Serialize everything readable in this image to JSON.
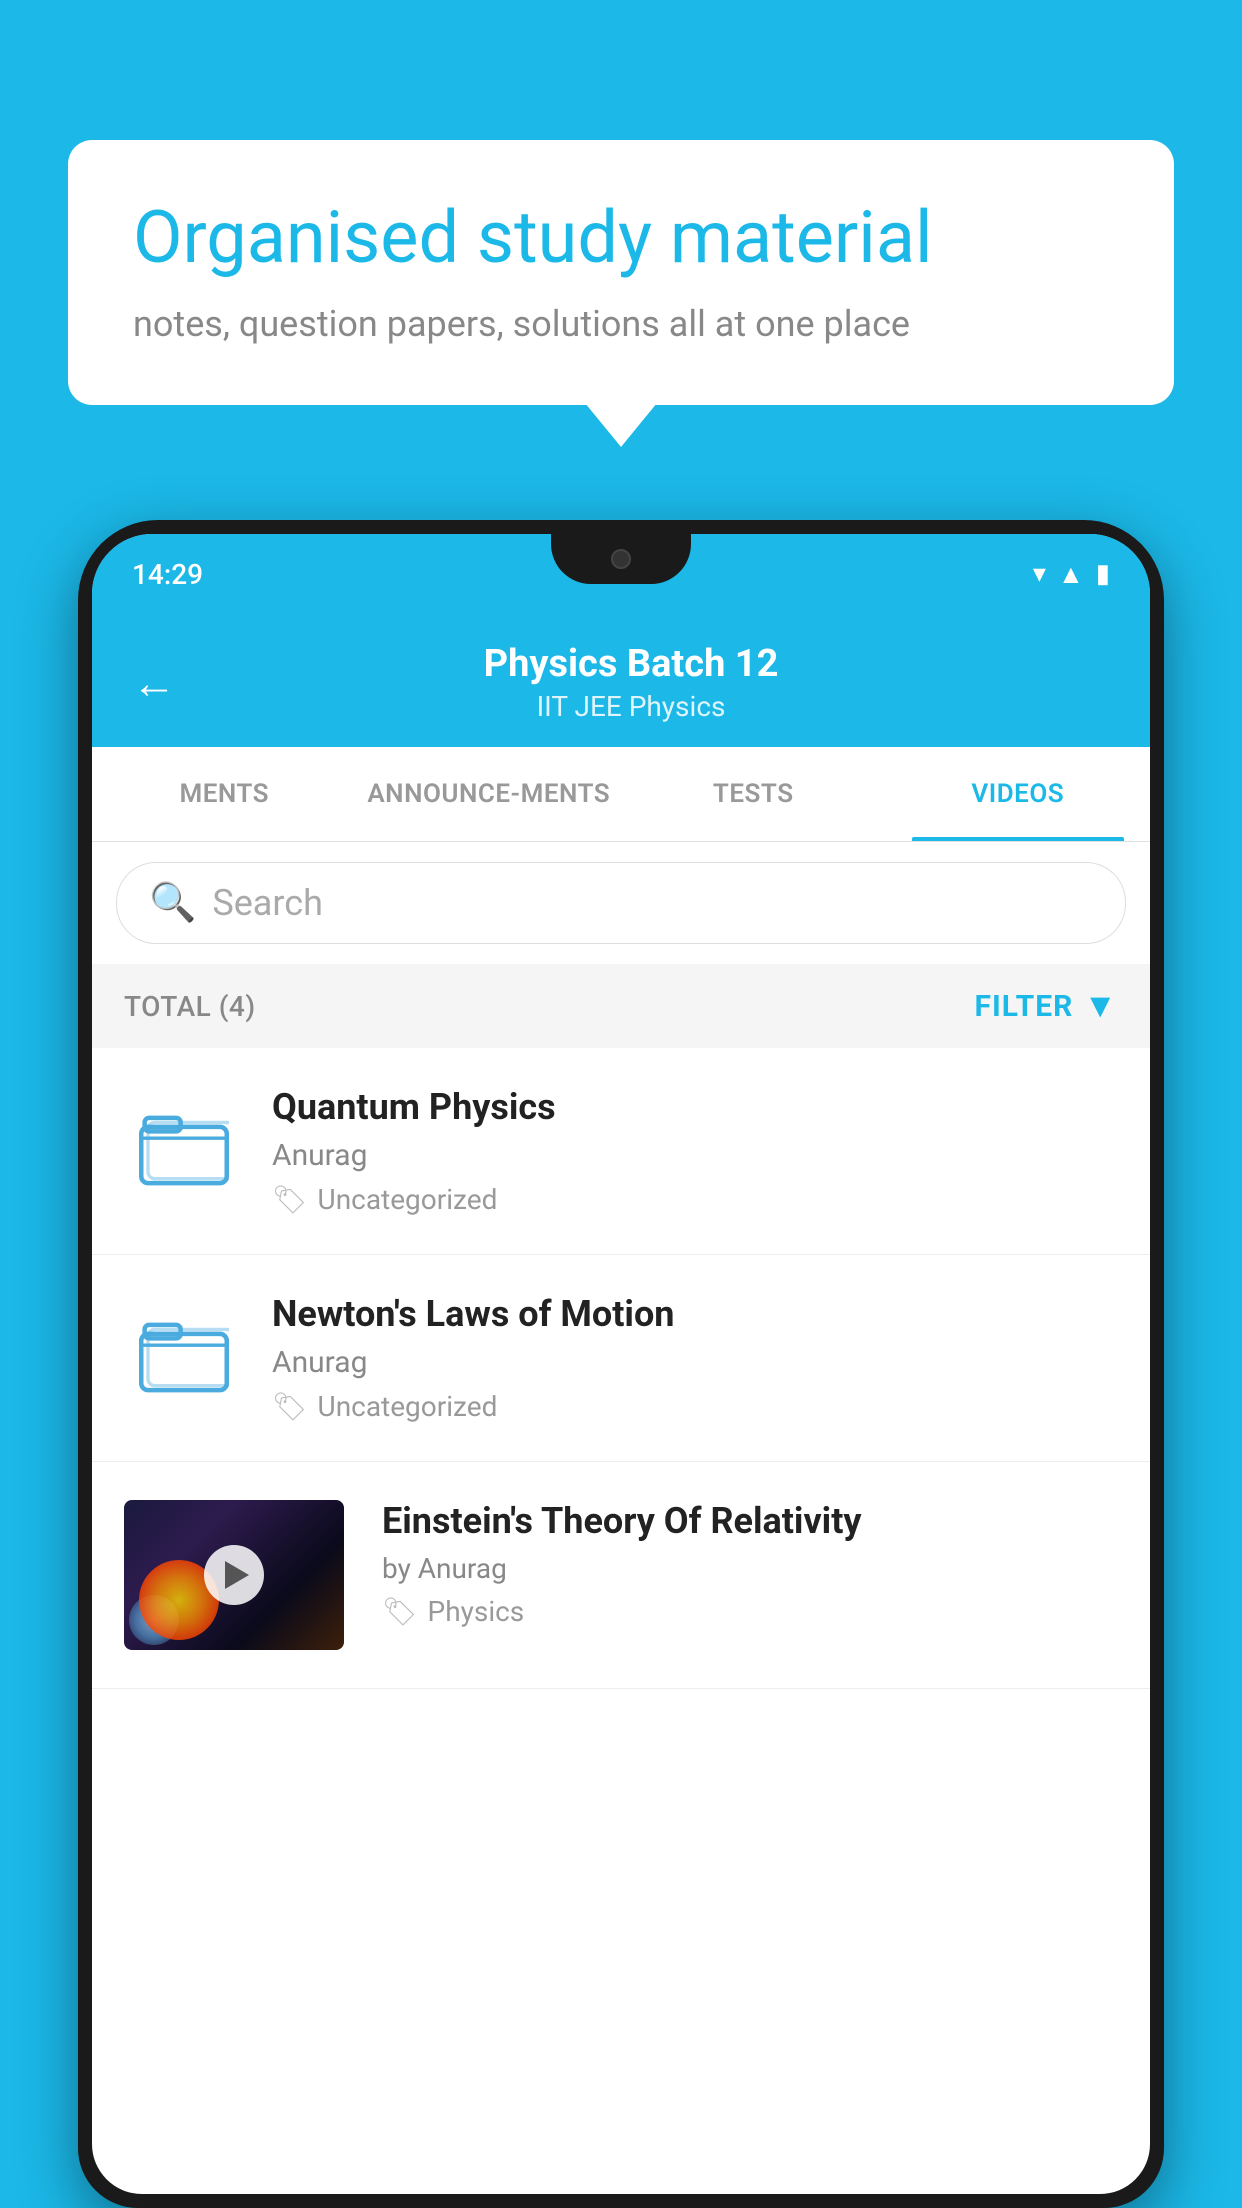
{
  "background_color": "#1BB8E8",
  "speech_bubble": {
    "heading": "Organised study material",
    "subtext": "notes, question papers, solutions all at one place"
  },
  "status_bar": {
    "time": "14:29"
  },
  "app_header": {
    "back_label": "←",
    "title": "Physics Batch 12",
    "tags": "IIT JEE    Physics"
  },
  "tabs": [
    {
      "label": "MENTS",
      "active": false
    },
    {
      "label": "ANNOUNCEMENTS",
      "active": false
    },
    {
      "label": "TESTS",
      "active": false
    },
    {
      "label": "VIDEOS",
      "active": true
    }
  ],
  "search": {
    "placeholder": "Search"
  },
  "filter_bar": {
    "total_label": "TOTAL (4)",
    "filter_label": "FILTER"
  },
  "videos": [
    {
      "id": "quantum",
      "title": "Quantum Physics",
      "author": "Anurag",
      "tag": "Uncategorized",
      "has_thumbnail": false
    },
    {
      "id": "newton",
      "title": "Newton's Laws of Motion",
      "author": "Anurag",
      "tag": "Uncategorized",
      "has_thumbnail": false
    },
    {
      "id": "einstein",
      "title": "Einstein's Theory Of Relativity",
      "author": "by Anurag",
      "tag": "Physics",
      "has_thumbnail": true
    }
  ]
}
